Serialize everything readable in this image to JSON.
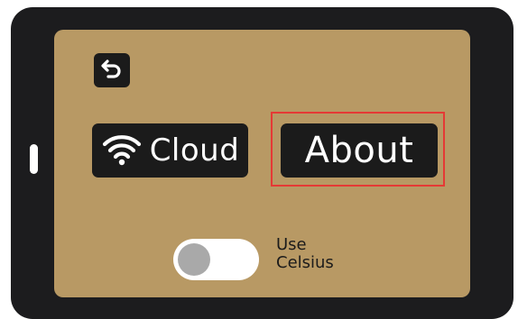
{
  "screen": {
    "back": {
      "icon": "back-arrow-icon"
    },
    "cloud": {
      "label": "Cloud",
      "icon": "wifi-icon"
    },
    "about": {
      "label": "About"
    },
    "celsius_toggle": {
      "label_line1": "Use",
      "label_line2": "Celsius",
      "enabled": false
    }
  },
  "colors": {
    "device_bezel": "#1c1c1e",
    "screen_bg": "#b89964",
    "button_bg": "#1b1b1b",
    "highlight": "#e53935",
    "toggle_knob_off": "#a9a9a9"
  }
}
